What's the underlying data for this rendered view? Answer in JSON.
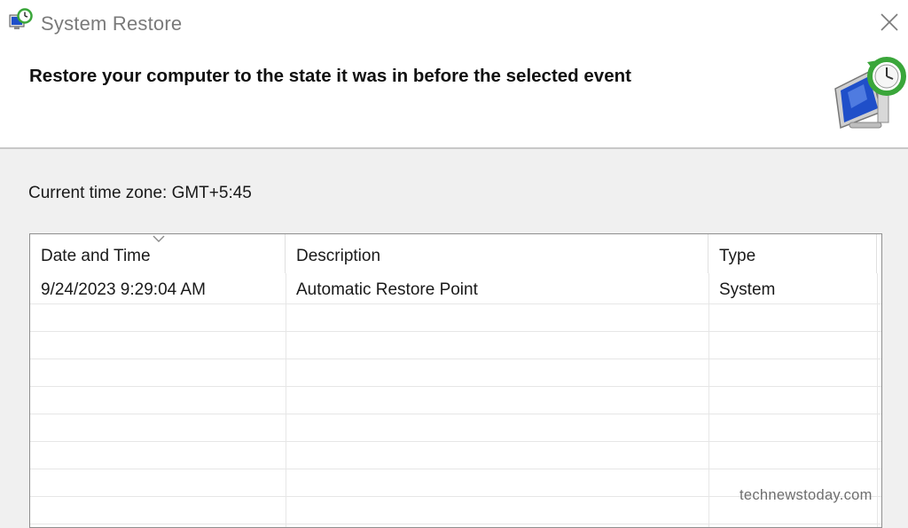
{
  "window": {
    "title": "System Restore",
    "app_icon": "system-restore-icon",
    "close_icon": "close-icon"
  },
  "header": {
    "title": "Restore your computer to the state it was in before the selected event",
    "icon": "computer-restore-clock-icon"
  },
  "timezone_label": "Current time zone: GMT+5:45",
  "restore_list": {
    "columns": [
      "Date and Time",
      "Description",
      "Type"
    ],
    "sorted_column": "Date and Time",
    "rows": [
      {
        "date_time": "9/24/2023 9:29:04 AM",
        "description": "Automatic Restore Point",
        "type": "System"
      }
    ]
  },
  "watermark": "technewstoday.com",
  "colors": {
    "accent_green": "#3aa63a",
    "screen_blue": "#1f4fc9",
    "dialog_bg": "#f0f0f0"
  }
}
